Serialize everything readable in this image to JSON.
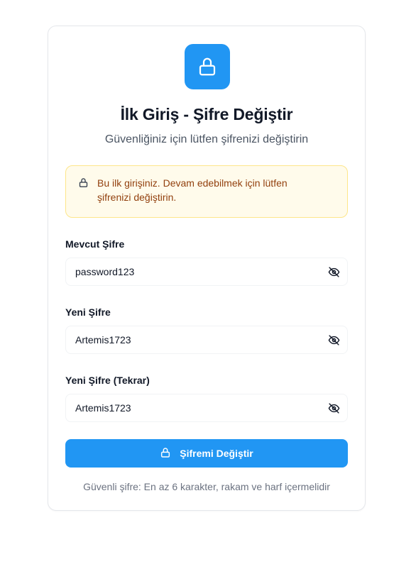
{
  "header": {
    "title": "İlk Giriş - Şifre Değiştir",
    "subtitle": "Güvenliğiniz için lütfen şifrenizi değiştirin"
  },
  "alert": {
    "icon": "lock-icon",
    "line1": "Bu ilk girişiniz. Devam edebilmek için lütfen",
    "line2": "şifrenizi değiştirin."
  },
  "form": {
    "current_password": {
      "label": "Mevcut Şifre",
      "value": "password123",
      "icon": "eye-off-icon"
    },
    "new_password": {
      "label": "Yeni Şifre",
      "value": "Artemis1723",
      "icon": "eye-off-icon"
    },
    "confirm_password": {
      "label": "Yeni Şifre (Tekrar)",
      "value": "Artemis1723",
      "icon": "eye-off-icon"
    },
    "submit_label": "Şifremi Değiştir"
  },
  "hint": "Güvenli şifre: En az 6 karakter, rakam ve harf içermelidir",
  "colors": {
    "accent": "#2196f3",
    "alert_bg": "#fffbeb",
    "alert_border": "#fde68a",
    "alert_text": "#92400e"
  }
}
